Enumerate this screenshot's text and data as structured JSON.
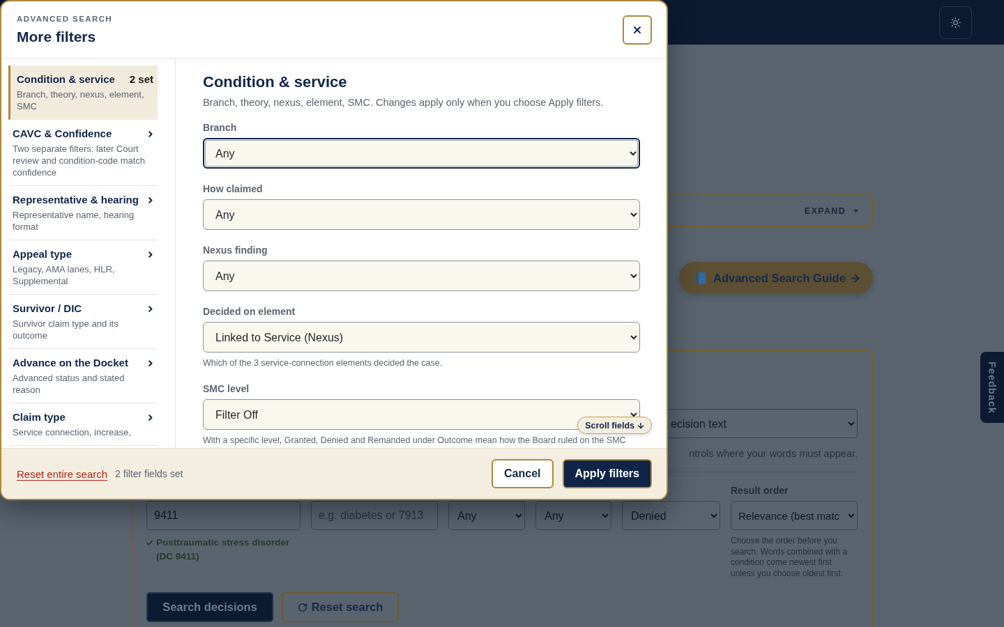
{
  "page": {
    "expand_panel": {
      "toggle": "EXPAND"
    },
    "guide_link": {
      "label": "Advanced Search Guide"
    },
    "search_card": {
      "match_select": {
        "value": "ecision text"
      },
      "match_hint": "ntrols where your words must appear.",
      "result_order_label": "Result order",
      "fields": [
        {
          "kind": "input",
          "value": "9411"
        },
        {
          "kind": "input",
          "placeholder": "e.g. diabetes or 7913"
        },
        {
          "kind": "select",
          "value": "Any"
        },
        {
          "kind": "select",
          "value": "Any"
        },
        {
          "kind": "select",
          "value": "Denied"
        },
        {
          "kind": "select",
          "value": "Relevance (best matc"
        }
      ],
      "condition_match": "Posttraumatic stress disorder (DC 9411)",
      "result_order_hint": "Choose the order before you search. Words combined with a condition come newest first unless you choose oldest first.",
      "buttons": [
        {
          "kind": "primary",
          "label": "Search decisions"
        },
        {
          "kind": "secondary",
          "label": "Reset search"
        }
      ]
    },
    "feedback_tab": {
      "label": "Feedback"
    }
  },
  "dialog": {
    "eyebrow": "ADVANCED SEARCH",
    "title": "More filters",
    "sections": [
      {
        "title": "Condition & service",
        "description": "Branch, theory, nexus, element, SMC",
        "count": "2 set",
        "selected": true
      },
      {
        "title": "CAVC & Confidence",
        "description": "Two separate filters: later Court review and condition-code match confidence",
        "selected": false
      },
      {
        "title": "Representative & hearing",
        "description": "Representative name, hearing format",
        "selected": false
      },
      {
        "title": "Appeal type",
        "description": "Legacy, AMA lanes, HLR, Supplemental",
        "selected": false
      },
      {
        "title": "Survivor / DIC",
        "description": "Survivor claim type and its outcome",
        "selected": false
      },
      {
        "title": "Advance on the Docket",
        "description": "Advanced status and stated reason",
        "selected": false
      },
      {
        "title": "Claim type",
        "description": "Service connection, increase,",
        "selected": false
      }
    ],
    "panel": {
      "heading": "Condition & service",
      "intro": "Branch, theory, nexus, element, SMC. Changes apply only when you choose Apply filters.",
      "fields": [
        {
          "label": "Branch",
          "value": "Any",
          "focused": true
        },
        {
          "label": "How claimed",
          "value": "Any",
          "focused": false
        },
        {
          "label": "Nexus finding",
          "value": "Any",
          "focused": false
        },
        {
          "label": "Decided on element",
          "value": "Linked to Service (Nexus)",
          "focused": false,
          "hint": "Which of the 3 service-connection elements decided the case."
        },
        {
          "label": "SMC level",
          "value": "Filter Off",
          "focused": false,
          "hint": "With a specific level, Granted, Denied and Remanded under Outcome mean how the Board ruled on the SMC"
        }
      ],
      "scroll_hint": "Scroll fields"
    },
    "footer": {
      "reset_link": "Reset entire search",
      "status": "2 filter fields set",
      "buttons": [
        {
          "kind": "secondary",
          "label": "Cancel"
        },
        {
          "kind": "primary",
          "label": "Apply filters"
        }
      ]
    }
  }
}
